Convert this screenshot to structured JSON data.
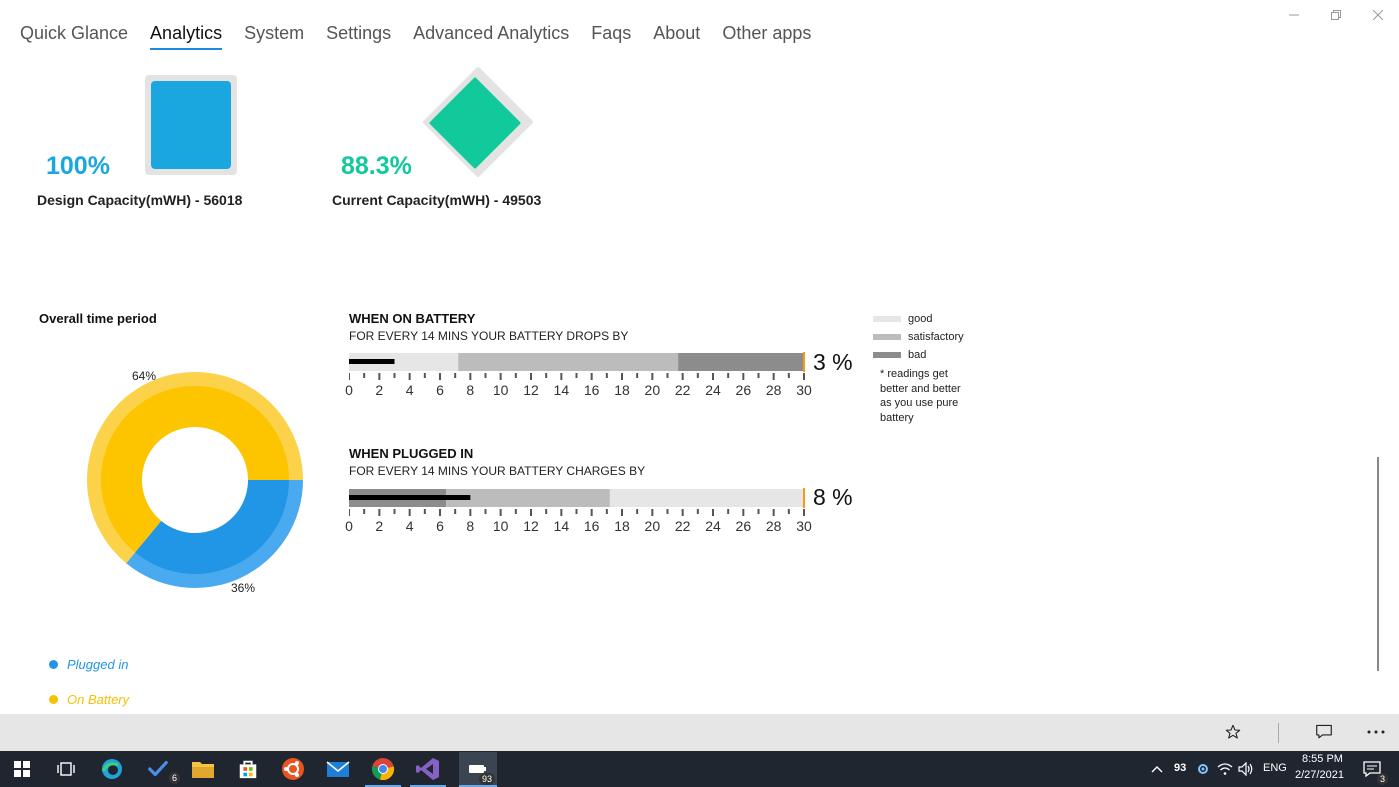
{
  "nav": {
    "tabs": [
      {
        "label": "Quick Glance"
      },
      {
        "label": "Analytics"
      },
      {
        "label": "System"
      },
      {
        "label": "Settings"
      },
      {
        "label": "Advanced Analytics"
      },
      {
        "label": "Faqs"
      },
      {
        "label": "About"
      },
      {
        "label": "Other apps"
      }
    ],
    "active": "Analytics"
  },
  "capacity": {
    "design": {
      "percent": "100%",
      "label": "Design Capacity(mWH) - 56018",
      "color": "#1aa7e0"
    },
    "current": {
      "percent": "88.3%",
      "label": "Current Capacity(mWH) - 49503",
      "color": "#12c99b"
    }
  },
  "overall": {
    "title": "Overall time period",
    "plugged_label": "64%",
    "battery_label": "36%",
    "legend": [
      {
        "label": "Plugged in",
        "color": "#2196e6"
      },
      {
        "label": "On Battery",
        "color": "#f3c200"
      }
    ]
  },
  "battery_gauge": {
    "title": "WHEN ON BATTERY",
    "subtitle": "FOR EVERY 14 MINS YOUR BATTERY DROPS BY",
    "value": "3 %"
  },
  "plugged_gauge": {
    "title": "WHEN PLUGGED IN",
    "subtitle": "FOR EVERY 14 MINS YOUR BATTERY CHARGES BY",
    "value": "8 %"
  },
  "scale": {
    "ticks": [
      "0",
      "2",
      "4",
      "6",
      "8",
      "10",
      "12",
      "14",
      "16",
      "18",
      "20",
      "22",
      "24",
      "26",
      "28",
      "30"
    ]
  },
  "key": {
    "items": [
      {
        "label": "good",
        "color": "#e6e6e6"
      },
      {
        "label": "satisfactory",
        "color": "#bcbcbc"
      },
      {
        "label": "bad",
        "color": "#8c8c8c"
      }
    ],
    "note": "* readings get better and better as you use pure battery"
  },
  "chart_data": [
    {
      "type": "pie",
      "title": "Overall time period",
      "categories": [
        "Plugged in",
        "On Battery"
      ],
      "values": [
        36,
        64
      ]
    },
    {
      "type": "bar",
      "title": "WHEN ON BATTERY",
      "categories": [
        "good",
        "satisfactory",
        "bad",
        "reading"
      ],
      "values": [
        7.2,
        21.7,
        30,
        3
      ],
      "xlim": [
        0,
        30
      ]
    },
    {
      "type": "bar",
      "title": "WHEN PLUGGED IN",
      "categories": [
        "bad",
        "satisfactory",
        "good",
        "reading"
      ],
      "values": [
        6.4,
        17.2,
        30,
        8
      ],
      "xlim": [
        0,
        30
      ]
    }
  ],
  "taskbar": {
    "badges": {
      "todo": "6",
      "app": "93"
    },
    "battery": "93",
    "language": "ENG",
    "time": "8:55 PM",
    "date": "2/27/2021",
    "notifications": "3"
  }
}
